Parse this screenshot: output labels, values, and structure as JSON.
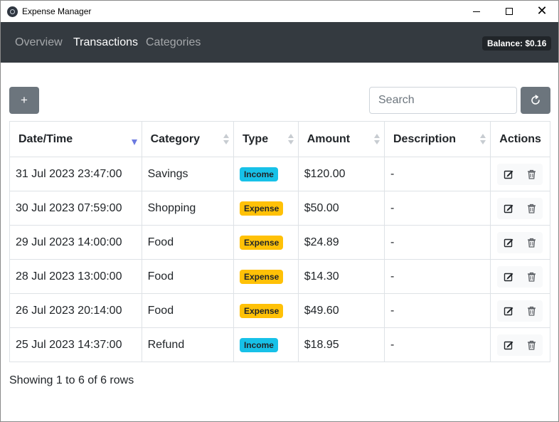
{
  "window": {
    "title": "Expense Manager"
  },
  "nav": {
    "items": [
      {
        "label": "Overview",
        "active": false
      },
      {
        "label": "Transactions",
        "active": true
      },
      {
        "label": "Categories",
        "active": false
      }
    ],
    "balance": "Balance: $0.16"
  },
  "toolbar": {
    "add_label": "+",
    "search_placeholder": "Search",
    "search_value": ""
  },
  "table": {
    "headers": {
      "datetime": "Date/Time",
      "category": "Category",
      "type": "Type",
      "amount": "Amount",
      "description": "Description",
      "actions": "Actions"
    },
    "sort": {
      "column": "datetime",
      "direction": "desc"
    },
    "rows": [
      {
        "datetime": "31 Jul 2023 23:47:00",
        "category": "Savings",
        "type": "Income",
        "amount": "$120.00",
        "description": "-"
      },
      {
        "datetime": "30 Jul 2023 07:59:00",
        "category": "Shopping",
        "type": "Expense",
        "amount": "$50.00",
        "description": "-"
      },
      {
        "datetime": "29 Jul 2023 14:00:00",
        "category": "Food",
        "type": "Expense",
        "amount": "$24.89",
        "description": "-"
      },
      {
        "datetime": "28 Jul 2023 13:00:00",
        "category": "Food",
        "type": "Expense",
        "amount": "$14.30",
        "description": "-"
      },
      {
        "datetime": "26 Jul 2023 20:14:00",
        "category": "Food",
        "type": "Expense",
        "amount": "$49.60",
        "description": "-"
      },
      {
        "datetime": "25 Jul 2023 14:37:00",
        "category": "Refund",
        "type": "Income",
        "amount": "$18.95",
        "description": "-"
      }
    ]
  },
  "footer": {
    "pagination_text": "Showing 1 to 6 of 6 rows"
  },
  "colors": {
    "navbar": "#343a40",
    "income_badge": "#17c1e8",
    "expense_badge": "#ffc107",
    "secondary_button": "#6c757d"
  },
  "icons": {
    "app": "app-icon",
    "refresh": "refresh-icon",
    "edit": "edit-icon",
    "delete": "trash-icon"
  }
}
